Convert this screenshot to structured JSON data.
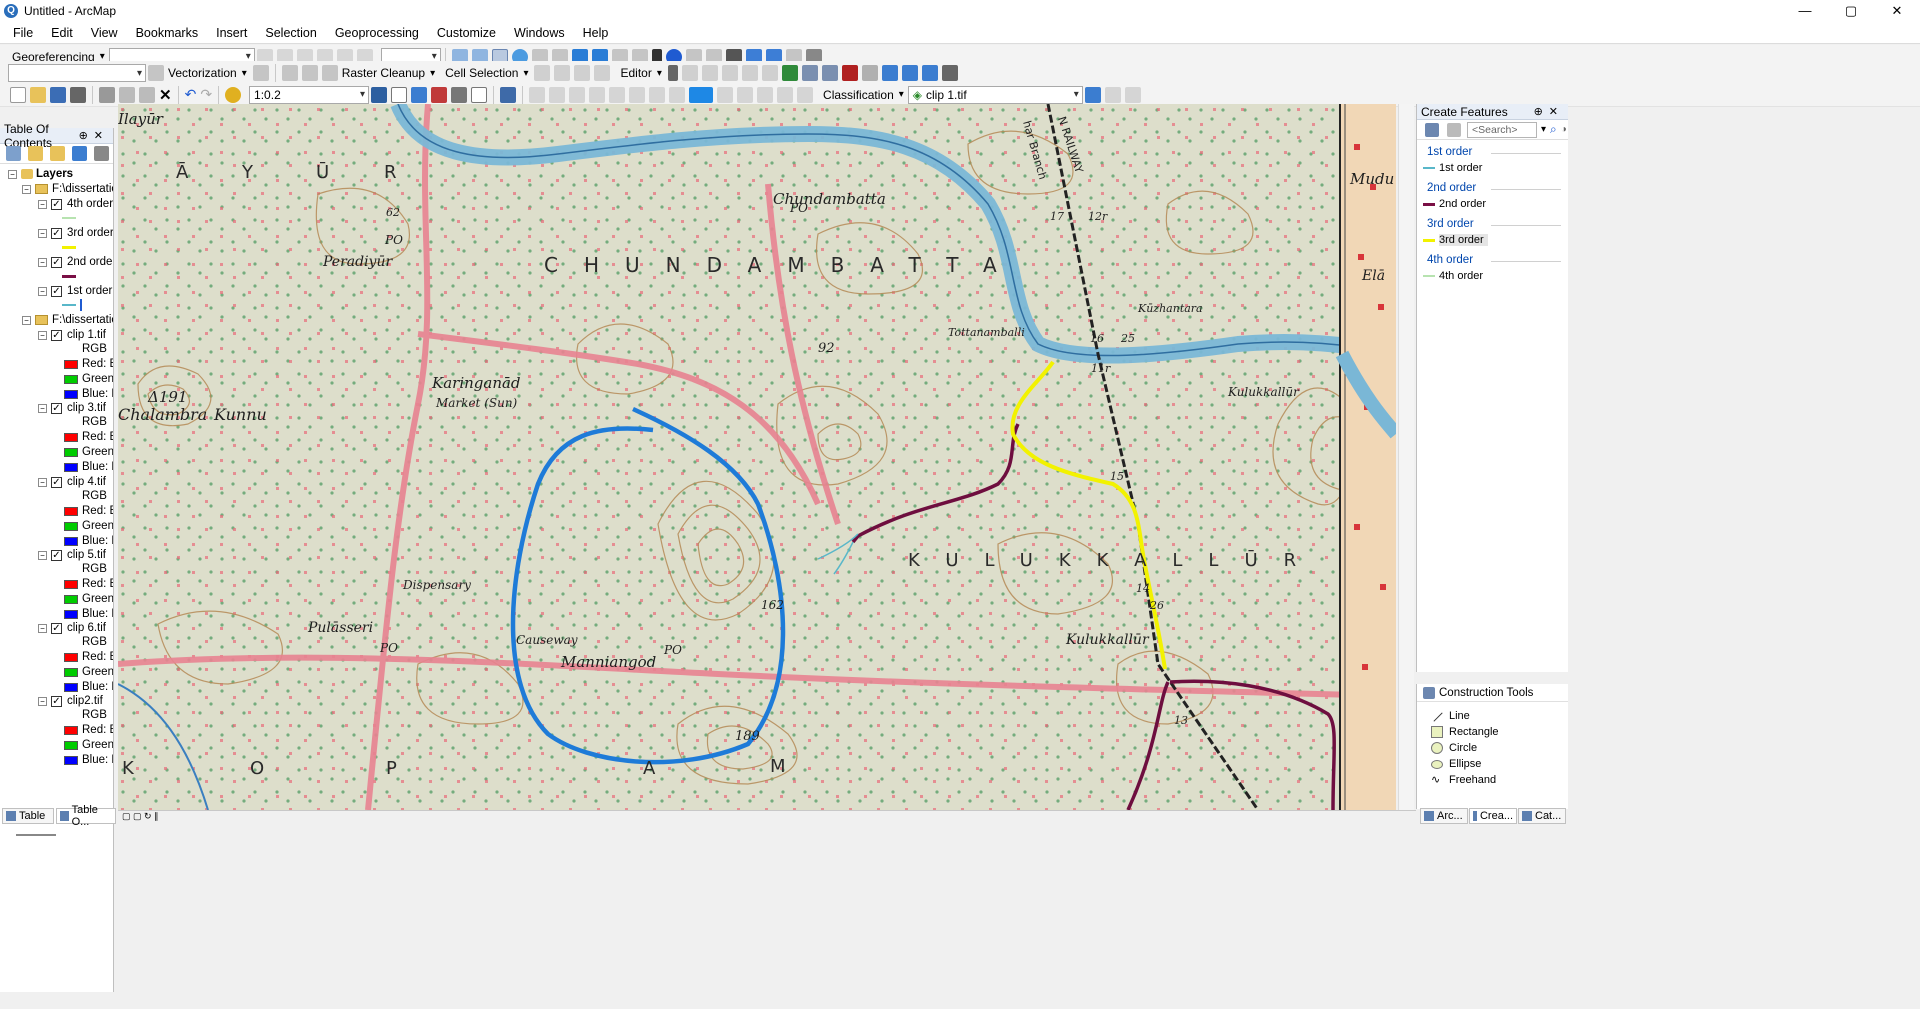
{
  "window": {
    "title": "Untitled - ArcMap",
    "minimize": "—",
    "maximize": "▢",
    "close": "✕"
  },
  "menu": [
    "File",
    "Edit",
    "View",
    "Bookmarks",
    "Insert",
    "Selection",
    "Geoprocessing",
    "Customize",
    "Windows",
    "Help"
  ],
  "toolbar1": {
    "georef_label": "Georeferencing"
  },
  "toolbar2": {
    "vectorization_label": "Vectorization",
    "raster_cleanup_label": "Raster Cleanup",
    "cell_selection_label": "Cell Selection",
    "editor_label": "Editor"
  },
  "toolbar3": {
    "scale_value": "1:0.2",
    "classification_label": "Classification",
    "layer_value": "clip 1.tif"
  },
  "toc": {
    "title": "Table Of Contents",
    "layers_root": "Layers",
    "folder1": "F:\\dissertatio",
    "vector_layers": [
      {
        "name": "4th order",
        "color": "#b7e3b0"
      },
      {
        "name": "3rd order",
        "color": "#f2f200"
      },
      {
        "name": "2nd order",
        "color": "#7a0f45"
      },
      {
        "name": "1st order",
        "color": "#59b7c9"
      }
    ],
    "folder2": "F:\\dissertatio",
    "rasters": [
      "clip 1.tif",
      "clip 3.tif",
      "clip 4.tif",
      "clip 5.tif",
      "clip 6.tif",
      "clip2.tif"
    ],
    "rgb_label": "RGB",
    "red_label": "Red:",
    "green_label": "Green:",
    "blue_label": "Blue:",
    "band_value": "B",
    "band_value_short": "E",
    "tab_table": "Table",
    "tab_toc": "Table O..."
  },
  "map": {
    "labels": [
      "Ilayūr",
      "Chundambatta",
      "Peradiyūr",
      "CHUNDAMBATTA",
      "Tottanamballi",
      "Kūzhantara",
      "Karinganād",
      "Market (Sun)",
      "Chalambra",
      "Kunnu",
      "Kulukkallūr",
      "Dispensary",
      "KULUKKALLŪR",
      "Pulāsseri",
      "Causeway",
      "Manniangod",
      "Kulukkallūr",
      "PO",
      "PO",
      "PO",
      "PO",
      "92",
      "162",
      "189",
      "15",
      "14",
      "13",
      "16",
      "17",
      "12r",
      "25",
      "11r",
      "26",
      "62",
      "Ā",
      "Y",
      "Ū",
      "R",
      "O",
      "P",
      "M",
      "A",
      "K",
      "Mudu",
      "Elā",
      "N RAILWAY",
      "har Branch",
      "Δ191"
    ]
  },
  "create_features": {
    "title": "Create Features",
    "search_placeholder": "<Search>",
    "groups": [
      {
        "header": "1st order",
        "item": "1st order",
        "color": "#59b7c9"
      },
      {
        "header": "2nd order",
        "item": "2nd order",
        "color": "#7a0f45"
      },
      {
        "header": "3rd order",
        "item": "3rd order",
        "color": "#f2f200"
      },
      {
        "header": "4th order",
        "item": "4th order",
        "color": "#b7e3b0"
      }
    ]
  },
  "construction_tools": {
    "title": "Construction Tools",
    "tools": [
      "Line",
      "Rectangle",
      "Circle",
      "Ellipse",
      "Freehand"
    ]
  },
  "right_tabs": [
    "Arc...",
    "Crea...",
    "Cat..."
  ]
}
